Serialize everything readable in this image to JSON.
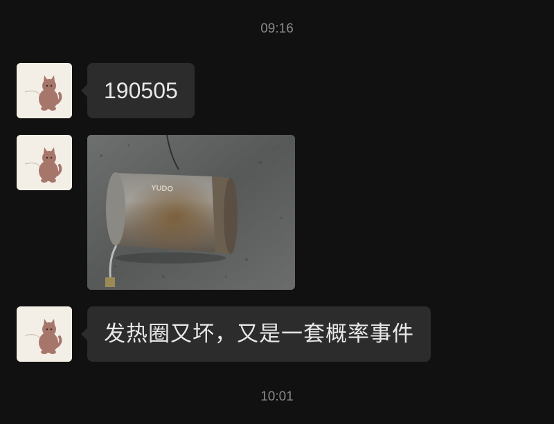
{
  "timestamps": {
    "top": "09:16",
    "bottom": "10:01"
  },
  "messages": [
    {
      "type": "text",
      "text": "190505",
      "sender_avatar": "cat-avatar"
    },
    {
      "type": "image",
      "image_desc_icon": "photo-heater-cylinder",
      "label_on_object": "YUDO",
      "sender_avatar": "cat-avatar"
    },
    {
      "type": "text",
      "text": "发热圈又坏，又是一套概率事件",
      "sender_avatar": "cat-avatar"
    }
  ],
  "colors": {
    "background": "#111111",
    "bubble": "#2c2c2c",
    "bubble_text": "#e8e8e8",
    "timestamp": "#8a8a8a",
    "avatar_bg": "#f4efe6",
    "cat": "#a7766b"
  }
}
